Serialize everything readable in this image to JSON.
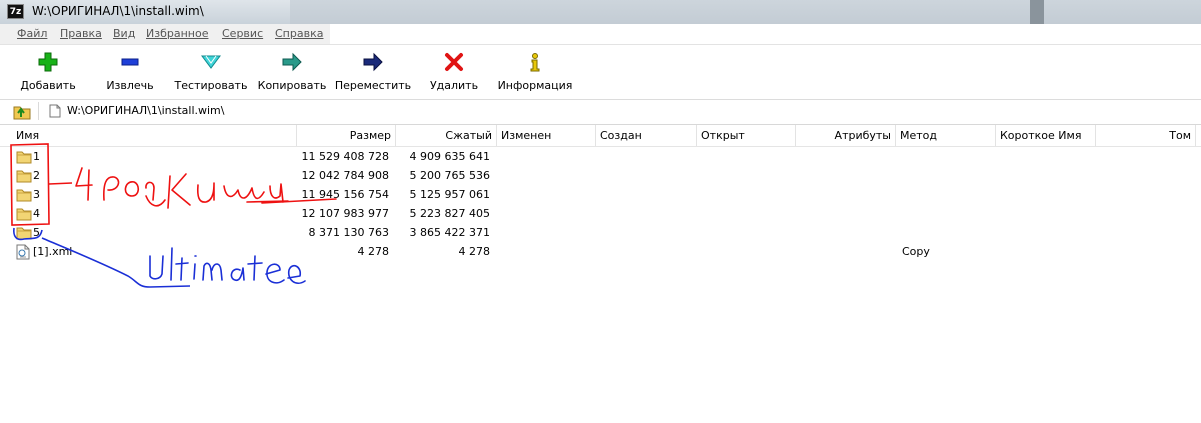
{
  "window": {
    "title": "W:\\ОРИГИНАЛ\\1\\install.wim\\",
    "app_icon_text": "7z"
  },
  "menu": [
    "Файл",
    "Правка",
    "Вид",
    "Избранное",
    "Сервис",
    "Справка"
  ],
  "toolbar": [
    {
      "label": "Добавить",
      "icon": "add-icon"
    },
    {
      "label": "Извлечь",
      "icon": "extract-icon"
    },
    {
      "label": "Тестировать",
      "icon": "test-icon"
    },
    {
      "label": "Копировать",
      "icon": "copy-icon"
    },
    {
      "label": "Переместить",
      "icon": "move-icon"
    },
    {
      "label": "Удалить",
      "icon": "delete-icon"
    },
    {
      "label": "Информация",
      "icon": "info-icon"
    }
  ],
  "address": {
    "path": "W:\\ОРИГИНАЛ\\1\\install.wim\\"
  },
  "columns": [
    "Имя",
    "Размер",
    "Сжатый",
    "Изменен",
    "Создан",
    "Открыт",
    "Атрибуты",
    "Метод",
    "Короткое Имя",
    "Том"
  ],
  "rows": [
    {
      "name": "1",
      "type": "folder",
      "size": "11 529 408 728",
      "packed": "4 909 635 641",
      "method": ""
    },
    {
      "name": "2",
      "type": "folder",
      "size": "12 042 784 908",
      "packed": "5 200 765 536",
      "method": ""
    },
    {
      "name": "3",
      "type": "folder",
      "size": "11 945 156 754",
      "packed": "5 125 957 061",
      "method": ""
    },
    {
      "name": "4",
      "type": "folder",
      "size": "12 107 983 977",
      "packed": "5 223 827 405",
      "method": ""
    },
    {
      "name": "5",
      "type": "folder",
      "size": "8 371 130 763",
      "packed": "3 865 422 371",
      "method": ""
    },
    {
      "name": "[1].xml",
      "type": "file",
      "size": "4 278",
      "packed": "4 278",
      "method": "Copy"
    }
  ],
  "annotations": {
    "red_text": "4 редакции",
    "blue_text": "Ultimate",
    "red_color": "#ee1111",
    "blue_color": "#1a2fd6"
  }
}
